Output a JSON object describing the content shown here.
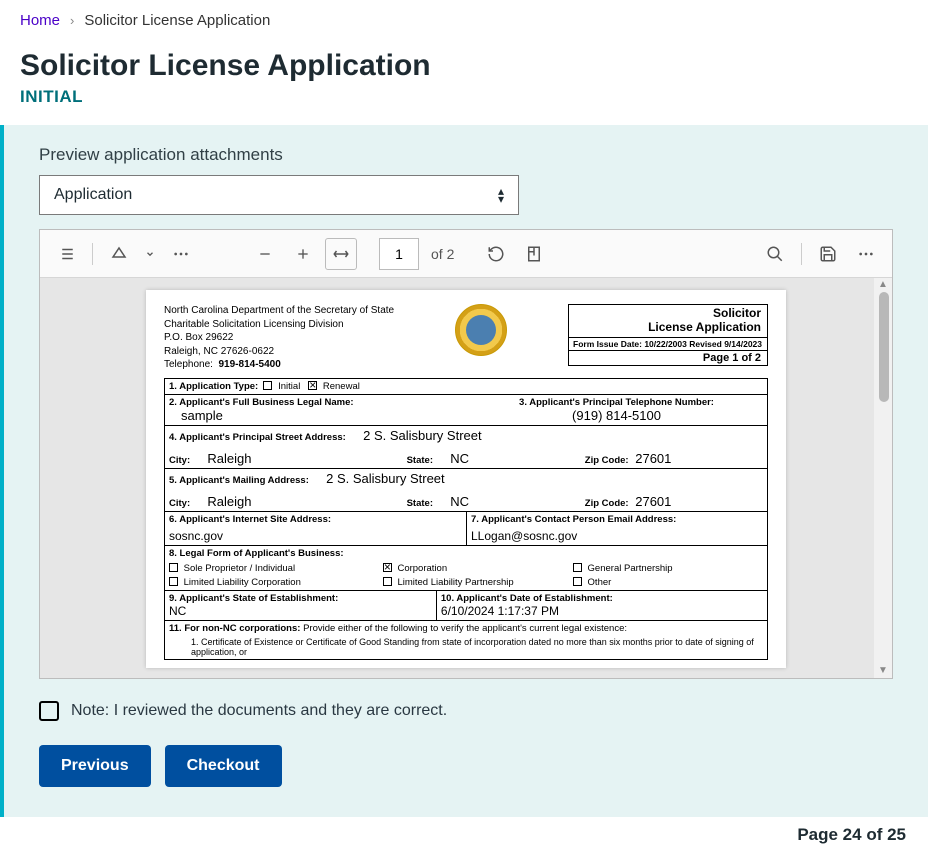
{
  "breadcrumb": {
    "home": "Home",
    "current": "Solicitor License Application"
  },
  "page": {
    "title": "Solicitor License Application",
    "subtitle": "INITIAL"
  },
  "preview": {
    "label": "Preview application attachments",
    "selected": "Application"
  },
  "pdf_toolbar": {
    "page_current": "1",
    "page_total": "of 2"
  },
  "document": {
    "dept_line1": "North Carolina Department of the Secretary of State",
    "dept_line2": "Charitable Solicitation Licensing Division",
    "dept_line3": "P.O. Box 29622",
    "dept_line4": "Raleigh, NC  27626-0622",
    "dept_phone_label": "Telephone:",
    "dept_phone": "919-814-5400",
    "title_line1": "Solicitor",
    "title_line2": "License Application",
    "issue_line": "Form Issue Date: 10/22/2003 Revised  9/14/2023",
    "page_line": "Page 1 of 2",
    "f1_label": "1. Application Type:",
    "f1_initial": "Initial",
    "f1_renewal": "Renewal",
    "f2_label": "2. Applicant's Full Business Legal Name:",
    "f2_value": "sample",
    "f3_label": "3. Applicant's Principal Telephone Number:",
    "f3_value": "(919) 814-5100",
    "f4_label": "4. Applicant's Principal Street Address:",
    "f4_value": "2 S. Salisbury Street",
    "city_label": "City:",
    "state_label": "State:",
    "zip_label": "Zip Code:",
    "f4_city": "Raleigh",
    "f4_state": "NC",
    "f4_zip": "27601",
    "f5_label": "5. Applicant's Mailing Address:",
    "f5_value": "2 S. Salisbury Street",
    "f5_city": "Raleigh",
    "f5_state": "NC",
    "f5_zip": "27601",
    "f6_label": "6. Applicant's Internet Site Address:",
    "f6_value": "sosnc.gov",
    "f7_label": "7. Applicant's  Contact Person Email Address:",
    "f7_value": "LLogan@sosnc.gov",
    "f8_label": "8. Legal Form of Applicant's Business:",
    "f8_sole": "Sole Proprietor / Individual",
    "f8_corp": "Corporation",
    "f8_gp": "General Partnership",
    "f8_llc": "Limited Liability Corporation",
    "f8_llp": "Limited Liability Partnership",
    "f8_other": "Other",
    "f9_label": "9. Applicant's State of Establishment:",
    "f9_value": "NC",
    "f10_label": "10. Applicant's Date of Establishment:",
    "f10_value": "6/10/2024 1:17:37 PM",
    "f11_label": "11. For non-NC corporations:",
    "f11_text": " Provide either of the following to verify the applicant's current legal existence:",
    "f11_sub": "1. Certificate of Existence or Certificate of Good Standing from state of incorporation dated no more than six months prior to date of signing of application, or"
  },
  "review": {
    "note": "Note: I reviewed the documents and they are correct."
  },
  "buttons": {
    "previous": "Previous",
    "checkout": "Checkout"
  },
  "footer": {
    "page_indicator": "Page 24 of 25"
  }
}
